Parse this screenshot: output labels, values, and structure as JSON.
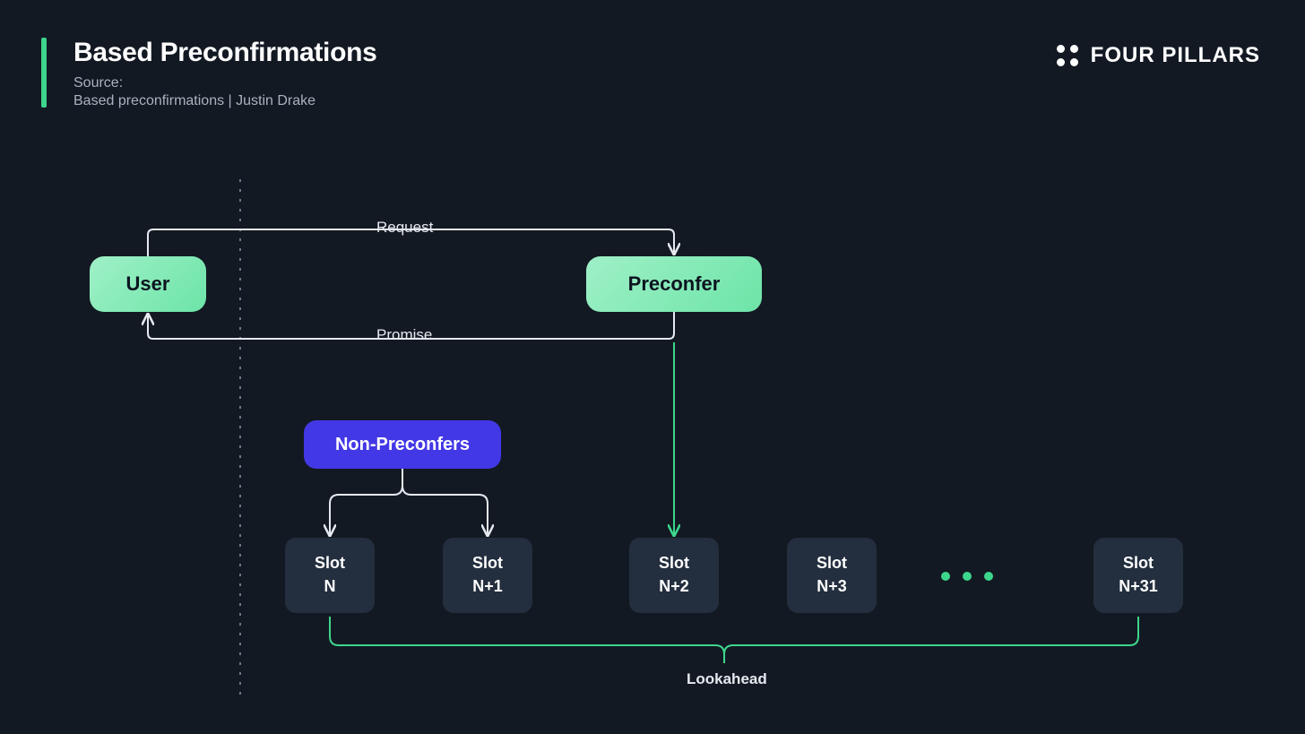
{
  "header": {
    "title": "Based Preconfirmations",
    "source_label": "Source:",
    "source_text": "Based preconfirmations | Justin Drake"
  },
  "brand": {
    "name": "FOUR PILLARS"
  },
  "nodes": {
    "user": "User",
    "preconfer": "Preconfer",
    "non_preconfers": "Non-Preconfers"
  },
  "arrows": {
    "request": "Request",
    "promise": "Promise"
  },
  "slots": [
    {
      "line1": "Slot",
      "line2": "N"
    },
    {
      "line1": "Slot",
      "line2": "N+1"
    },
    {
      "line1": "Slot",
      "line2": "N+2"
    },
    {
      "line1": "Slot",
      "line2": "N+3"
    },
    {
      "line1": "Slot",
      "line2": "N+31"
    }
  ],
  "lookahead_label": "Lookahead",
  "colors": {
    "bg": "#131923",
    "accent": "#3DD68C",
    "node_green_light": "#9FF0C7",
    "node_green_dark": "#6DE4A8",
    "blue": "#4338E6",
    "slot_bg": "#232E3E"
  }
}
